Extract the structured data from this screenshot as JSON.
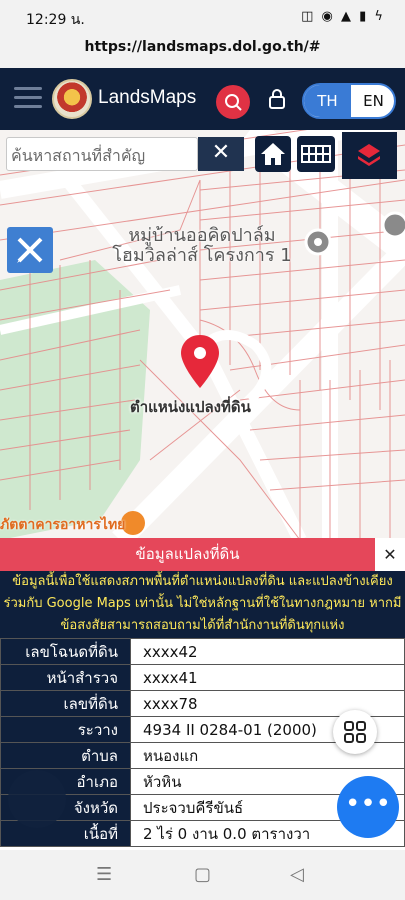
{
  "status_bar": {
    "time": "12:29 น.",
    "icons": "◫ ◉ ▲ ▮ ϟ"
  },
  "browser": {
    "url": "https://landsmaps.dol.go.th/#"
  },
  "header": {
    "brand": "LandsMaps",
    "lang_th": "TH",
    "lang_en": "EN"
  },
  "map": {
    "search_placeholder": "ค้นหาสถานที่สำคัญ",
    "clear_label": "✕",
    "village_line1": "หมู่บ้านออคิดปาล์ม",
    "village_line2": "โฮมวิลล่าส์ โครงการ 1",
    "parcel_label": "ตำแหน่งแปลงที่ดิน",
    "restaurant_label": "ภัตตาคารอาหารไทย"
  },
  "panel": {
    "title": "ข้อมูลแปลงที่ดิน",
    "close": "✕",
    "notice": "ข้อมูลนี้เพื่อใช้แสดงสภาพพื้นที่ตำแหน่งแปลงที่ดิน และแปลงข้างเคียงร่วมกับ Google Maps เท่านั้น ไม่ใช่หลักฐานที่ใช้ในทางกฎหมาย หากมีข้อสงสัยสามารถสอบถามได้ที่สำนักงานที่ดินทุกแห่ง",
    "rows": [
      {
        "key": "เลขโฉนดที่ดิน",
        "value": "xxxx42"
      },
      {
        "key": "หน้าสำรวจ",
        "value": "xxxx41"
      },
      {
        "key": "เลขที่ดิน",
        "value": "xxxx78"
      },
      {
        "key": "ระวาง",
        "value": "4934 II 0284-01 (2000)"
      },
      {
        "key": "ตำบล",
        "value": "หนองแก"
      },
      {
        "key": "อำเภอ",
        "value": "หัวหิน"
      },
      {
        "key": "จังหวัด",
        "value": "ประจวบคีรีขันธ์"
      },
      {
        "key": "เนื้อที่",
        "value": "2 ไร่ 0 งาน 0.0 ตารางวา"
      }
    ]
  },
  "fab": {
    "more": "•••"
  },
  "navbar": {
    "recent": "☰",
    "home": "▢",
    "back": "◁"
  },
  "colors": {
    "header_bg": "#0e1f3b",
    "accent_red": "#e5475a",
    "accent_blue": "#1e7bf2",
    "notice_text": "#ffe95a"
  }
}
